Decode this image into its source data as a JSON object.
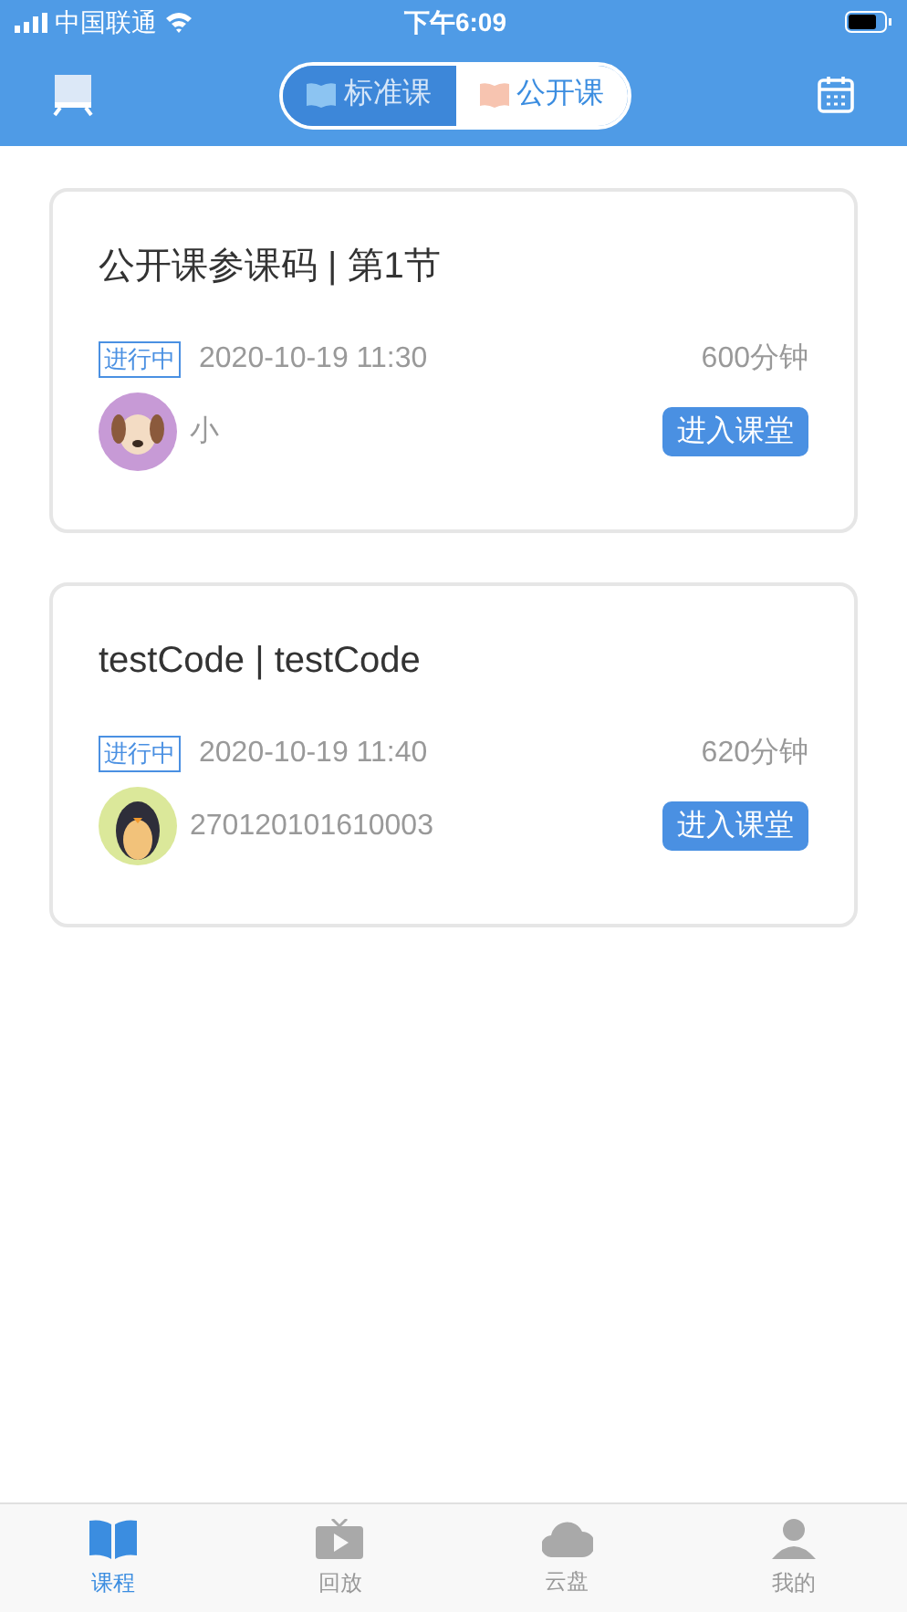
{
  "status_bar": {
    "carrier": "中国联通",
    "time": "下午6:09"
  },
  "segments": [
    {
      "label": "标准课",
      "selected": false
    },
    {
      "label": "公开课",
      "selected": true
    }
  ],
  "courses": [
    {
      "title": "公开课参课码 | 第1节",
      "status": "进行中",
      "datetime": "2020-10-19 11:30",
      "duration": "600分钟",
      "teacher": "小",
      "kind": "dog",
      "button": "进入课堂"
    },
    {
      "title": "testCode | testCode",
      "status": "进行中",
      "datetime": "2020-10-19 11:40",
      "duration": "620分钟",
      "teacher": "270120101610003",
      "kind": "penguin",
      "button": "进入课堂"
    }
  ],
  "tab_bar": [
    {
      "label": "课程",
      "selected": true,
      "kind": "book"
    },
    {
      "label": "回放",
      "selected": false,
      "kind": "tv"
    },
    {
      "label": "云盘",
      "selected": false,
      "kind": "cloud"
    },
    {
      "label": "我的",
      "selected": false,
      "kind": "person"
    }
  ]
}
